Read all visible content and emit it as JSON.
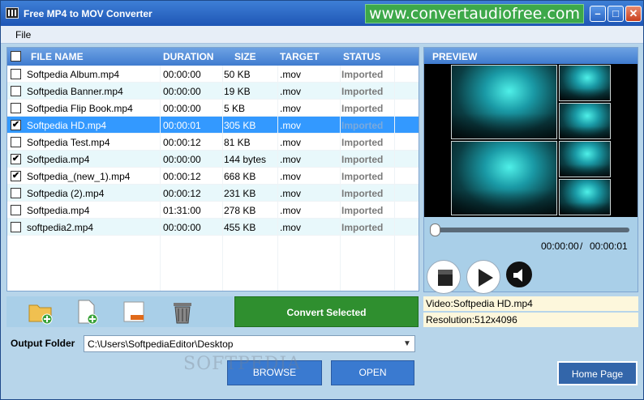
{
  "window": {
    "title": "Free MP4 to MOV Converter",
    "site_banner": "www.convertaudiofree.com"
  },
  "menu": {
    "file": "File"
  },
  "table": {
    "headers": [
      "FILE NAME",
      "DURATION",
      "SIZE",
      "TARGET",
      "STATUS"
    ],
    "rows": [
      {
        "checked": false,
        "name": "Softpedia Album.mp4",
        "duration": "00:00:00",
        "size": "50 KB",
        "target": ".mov",
        "status": "Imported"
      },
      {
        "checked": false,
        "name": "Softpedia Banner.mp4",
        "duration": "00:00:00",
        "size": "19 KB",
        "target": ".mov",
        "status": "Imported"
      },
      {
        "checked": false,
        "name": "Softpedia Flip Book.mp4",
        "duration": "00:00:00",
        "size": "5 KB",
        "target": ".mov",
        "status": "Imported"
      },
      {
        "checked": true,
        "name": "Softpedia HD.mp4",
        "duration": "00:00:01",
        "size": "305 KB",
        "target": ".mov",
        "status": "Imported",
        "selected": true
      },
      {
        "checked": false,
        "name": "Softpedia Test.mp4",
        "duration": "00:00:12",
        "size": "81 KB",
        "target": ".mov",
        "status": "Imported"
      },
      {
        "checked": true,
        "name": "Softpedia.mp4",
        "duration": "00:00:00",
        "size": "144 bytes",
        "target": ".mov",
        "status": "Imported"
      },
      {
        "checked": true,
        "name": "Softpedia_(new_1).mp4",
        "duration": "00:00:12",
        "size": "668 KB",
        "target": ".mov",
        "status": "Imported"
      },
      {
        "checked": false,
        "name": "Softpedia (2).mp4",
        "duration": "00:00:12",
        "size": "231 KB",
        "target": ".mov",
        "status": "Imported"
      },
      {
        "checked": false,
        "name": "Softpedia.mp4",
        "duration": "01:31:00",
        "size": "278 KB",
        "target": ".mov",
        "status": "Imported"
      },
      {
        "checked": false,
        "name": "softpedia2.mp4",
        "duration": "00:00:00",
        "size": "455 KB",
        "target": ".mov",
        "status": "Imported"
      }
    ]
  },
  "toolbar": {
    "icons": [
      "add-folder-icon",
      "add-file-icon",
      "remove-file-icon",
      "trash-icon"
    ],
    "convert_label": "Convert Selected"
  },
  "output": {
    "label": "Output Folder",
    "path": "C:\\Users\\SoftpediaEditor\\Desktop",
    "browse_label": "BROWSE",
    "open_label": "OPEN"
  },
  "preview": {
    "header": "PREVIEW",
    "current_time": "00:00:00",
    "separator": "/",
    "total_time": "00:00:01",
    "controls": [
      "stop-icon",
      "play-icon",
      "volume-icon"
    ],
    "video_info": "Video:Softpedia HD.mp4",
    "resolution_info": "Resolution:512x4096"
  },
  "home_page_label": "Home Page",
  "watermark": "SOFTPEDIA",
  "colors": {
    "title_gradient": "#1f56b5",
    "accent": "#3a7ad0",
    "convert_green": "#2f8f2f",
    "selection": "#3399ff"
  }
}
